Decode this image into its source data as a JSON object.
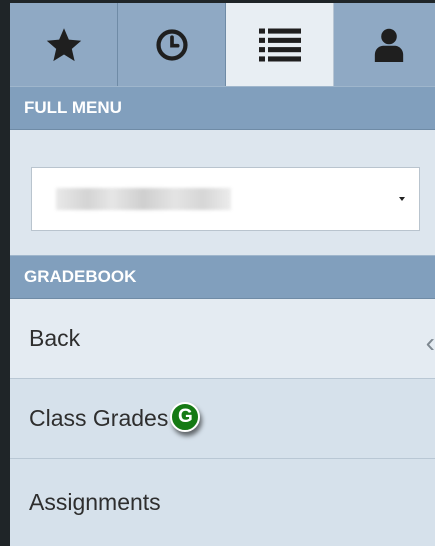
{
  "tabs": [
    {
      "name": "favorites",
      "icon": "star-icon"
    },
    {
      "name": "recent",
      "icon": "clock-icon"
    },
    {
      "name": "full-menu",
      "icon": "list-icon",
      "active": true
    },
    {
      "name": "account",
      "icon": "user-icon"
    }
  ],
  "full_menu": {
    "header": "FULL MENU",
    "select": {
      "value": ""
    }
  },
  "gradebook": {
    "header": "GRADEBOOK",
    "items": [
      {
        "label": "Back",
        "chevron": "‹"
      },
      {
        "label": "Class Grades",
        "badge": "G"
      },
      {
        "label": "Assignments"
      }
    ]
  },
  "colors": {
    "tab_bar": "#8fa9c4",
    "section_header": "#819fbd",
    "active_tab": "#e8eef3",
    "row_bg": "#d6e1eb",
    "badge_green": "#157a14"
  }
}
